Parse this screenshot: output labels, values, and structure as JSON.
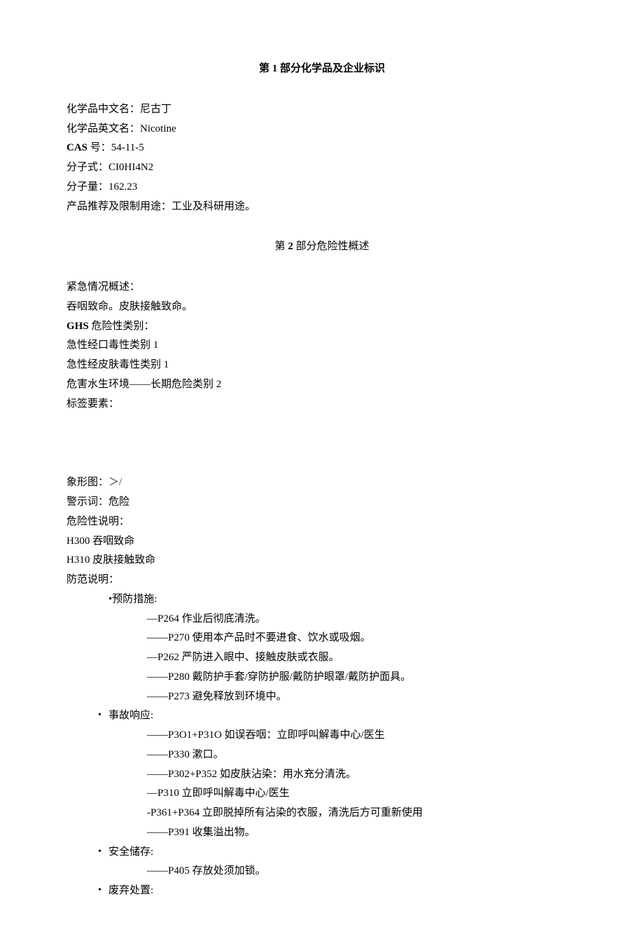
{
  "section1": {
    "title_prefix": "第 ",
    "title_num": "1",
    "title_suffix": " 部分化学品及企业标识",
    "lines": {
      "name_cn_label": "化学品中文名：",
      "name_cn_value": "尼古丁",
      "name_en_label": "化学品英文名：",
      "name_en_value": "Nicotine",
      "cas_label": "CAS",
      "cas_suffix": " 号：",
      "cas_value": "54-11-5",
      "formula_label": "分子式：",
      "formula_value": "CI0HI4N2",
      "weight_label": "分子量：",
      "weight_value": "162.23",
      "usage_label": "产品推荐及限制用途：",
      "usage_value": "工业及科研用途。"
    }
  },
  "section2": {
    "title_prefix": "第 ",
    "title_num": "2",
    "title_suffix": " 部分危险性概述",
    "emergency_label": "紧急情况概述：",
    "emergency_text": "吞咽致命。皮肤接触致命。",
    "ghs_label_bold": "GHS",
    "ghs_label_rest": " 危险性类别：",
    "ghs_lines": [
      "急性经口毒性类别 1",
      "急性经皮肤毒性类别 1",
      "危害水生环境——长期危险类别 2"
    ],
    "label_elements": "标签要素：",
    "pictogram_label": "象形图：",
    "pictogram_symbol": "＞/",
    "signal_label": "警示词：",
    "signal_value": "危险",
    "hazard_label": "危险性说明：",
    "hazard_statements": [
      "H300 吞咽致命",
      "H310 皮肤接触致命"
    ],
    "precaution_label": "防范说明：",
    "precaution_groups": [
      {
        "header": "•预防措施:",
        "header_no_bullet": true,
        "items": [
          "—P264 作业后彻底清洗。",
          "——P270 使用本产品时不要进食、饮水或吸烟。",
          "—P262 严防进入眼中、接触皮肤或衣服。",
          "——P280 戴防护手套/穿防护服/戴防护眼罩/戴防护面具。",
          "——P273 避免释放到环境中。"
        ]
      },
      {
        "header": "事故响应:",
        "items": [
          "——P3O1+P31O 如误吞咽：立即呼叫解毒中心/医生",
          "——P330 漱口。",
          "——P302+P352 如皮肤沾染：用水充分清洗。",
          "—P310 立即呼叫解毒中心/医生",
          "-P361+P364 立即脱掉所有沾染的衣服，清洗后方可重新使用",
          "——P391 收集溢出物。"
        ]
      },
      {
        "header": "安全储存:",
        "items": [
          "——P405 存放处须加锁。"
        ]
      },
      {
        "header": "废弃处置:",
        "items": []
      }
    ]
  }
}
